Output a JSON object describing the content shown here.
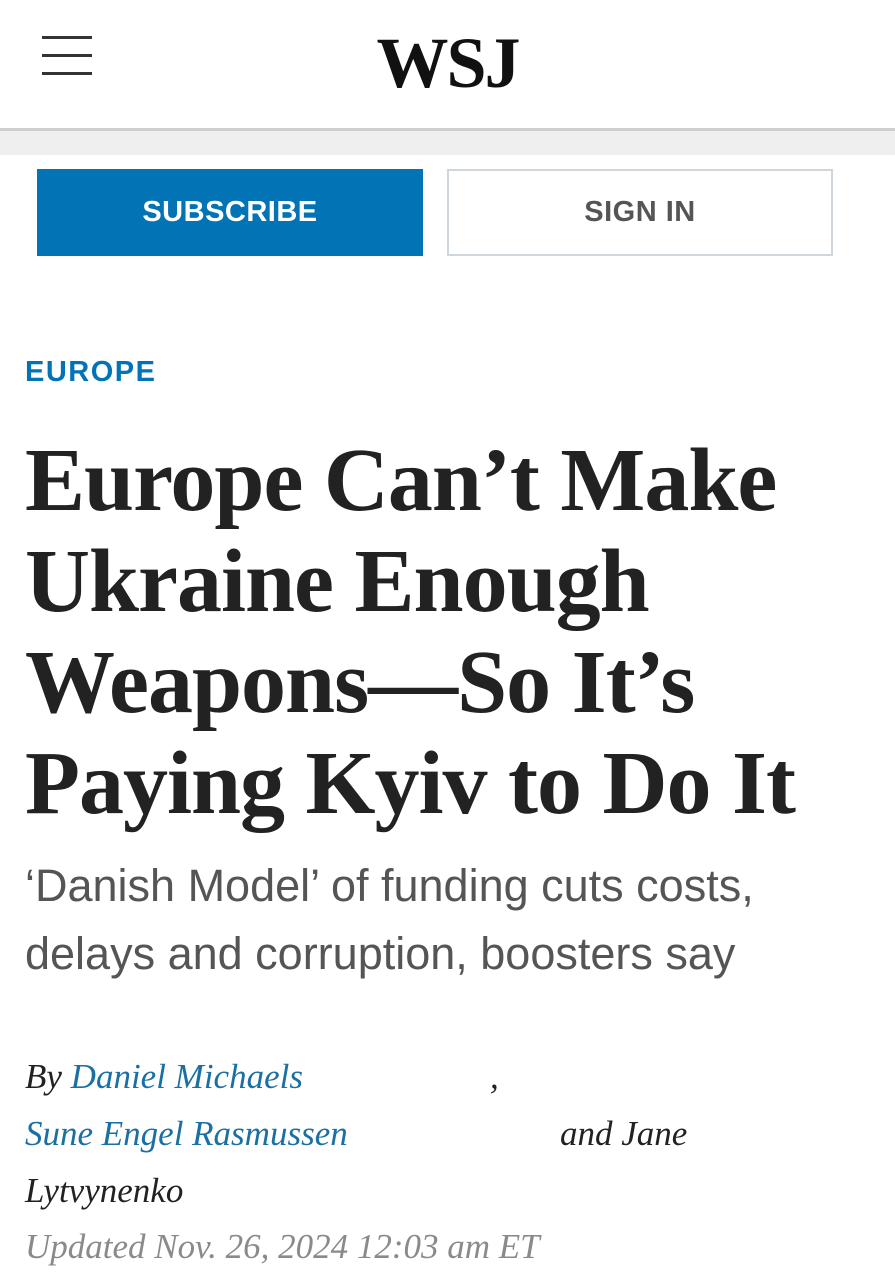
{
  "header": {
    "logo": "WSJ",
    "menu_icon": "hamburger-menu-icon"
  },
  "actions": {
    "subscribe_label": "SUBSCRIBE",
    "signin_label": "SIGN IN"
  },
  "article": {
    "section": "EUROPE",
    "headline_lines": [
      "Europe Can’t Make",
      "Ukraine Enough",
      "Weapons—So It’s",
      "Paying Kyiv to Do It"
    ],
    "dek_lines": [
      "‘Danish Model’ of funding cuts costs,",
      "delays and corruption, boosters say"
    ],
    "byline": {
      "prefix": "By",
      "author_1": "Daniel Michaels",
      "comma": ",",
      "author_2": "Sune Engel Rasmussen",
      "and_text": "and Jane",
      "author_3": "Lytvynenko"
    },
    "timestamp": "Updated Nov. 26, 2024 12:03 am ET"
  },
  "colors": {
    "accent": "#0274b6",
    "link": "#1a6fa3",
    "text": "#222222",
    "dek": "#555555",
    "muted": "#8a8a8a"
  }
}
